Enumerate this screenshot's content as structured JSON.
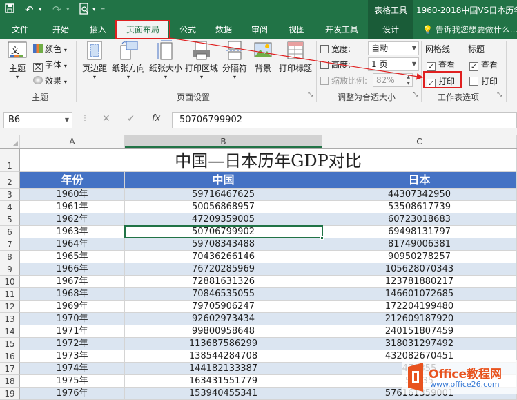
{
  "window": {
    "title": "1960-2018中国VS日本历年G",
    "tools_tab": "表格工具"
  },
  "tabs": [
    {
      "label": "文件"
    },
    {
      "label": "开始"
    },
    {
      "label": "插入"
    },
    {
      "label": "页面布局"
    },
    {
      "label": "公式"
    },
    {
      "label": "数据"
    },
    {
      "label": "审阅"
    },
    {
      "label": "视图"
    },
    {
      "label": "开发工具"
    },
    {
      "label": "设计"
    }
  ],
  "tell_me": "告诉我您想要做什么...",
  "ribbon": {
    "themes": {
      "group": "主题",
      "themes_btn": "主题",
      "colors": "颜色",
      "fonts": "字体",
      "effects": "效果"
    },
    "page_setup": {
      "group": "页面设置",
      "margins": "页边距",
      "orientation": "纸张方向",
      "size": "纸张大小",
      "print_area": "打印区域",
      "breaks": "分隔符",
      "background": "背景",
      "print_titles": "打印标题"
    },
    "scale": {
      "group": "调整为合适大小",
      "width_label": "宽度:",
      "width_value": "自动",
      "height_label": "高度:",
      "height_value": "1 页",
      "scale_label": "缩放比例:",
      "scale_value": "82%"
    },
    "sheet_options": {
      "group": "工作表选项",
      "gridlines": "网格线",
      "headings": "标题",
      "view": "查看",
      "print": "打印"
    }
  },
  "formula_bar": {
    "name_box": "B6",
    "value": "50706799902",
    "fx": "fx"
  },
  "sheet": {
    "columns": [
      "A",
      "B",
      "C"
    ],
    "title": "中国—日本历年GDP对比",
    "headers": [
      "年份",
      "中国",
      "日本"
    ],
    "rows": [
      {
        "n": "3",
        "year": "1960年",
        "cn": "59716467625",
        "jp": "44307342950"
      },
      {
        "n": "4",
        "year": "1961年",
        "cn": "50056868957",
        "jp": "53508617739"
      },
      {
        "n": "5",
        "year": "1962年",
        "cn": "47209359005",
        "jp": "60723018683"
      },
      {
        "n": "6",
        "year": "1963年",
        "cn": "50706799902",
        "jp": "69498131797"
      },
      {
        "n": "7",
        "year": "1964年",
        "cn": "59708343488",
        "jp": "81749006381"
      },
      {
        "n": "8",
        "year": "1965年",
        "cn": "70436266146",
        "jp": "90950278257"
      },
      {
        "n": "9",
        "year": "1966年",
        "cn": "76720285969",
        "jp": "105628070343"
      },
      {
        "n": "10",
        "year": "1967年",
        "cn": "72881631326",
        "jp": "123781880217"
      },
      {
        "n": "11",
        "year": "1968年",
        "cn": "70846535055",
        "jp": "146601072685"
      },
      {
        "n": "12",
        "year": "1969年",
        "cn": "79705906247",
        "jp": "172204199480"
      },
      {
        "n": "13",
        "year": "1970年",
        "cn": "92602973434",
        "jp": "212609187920"
      },
      {
        "n": "14",
        "year": "1971年",
        "cn": "99800958648",
        "jp": "240151807459"
      },
      {
        "n": "15",
        "year": "1972年",
        "cn": "113687586299",
        "jp": "318031297492"
      },
      {
        "n": "16",
        "year": "1973年",
        "cn": "138544284708",
        "jp": "432082670451"
      },
      {
        "n": "17",
        "year": "1974年",
        "cn": "144182133387",
        "jp": "479355"
      },
      {
        "n": "18",
        "year": "1975年",
        "cn": "163431551779",
        "jp": "52135"
      },
      {
        "n": "19",
        "year": "1976年",
        "cn": "153940455341",
        "jp": "576161359001"
      }
    ]
  },
  "watermark": {
    "line1": "Office教程网",
    "line2": "www.office26.com"
  },
  "colors": {
    "brand": "#217346",
    "header_fill": "#4472c4",
    "band": "#dbe5f1",
    "highlight": "#e02020"
  }
}
